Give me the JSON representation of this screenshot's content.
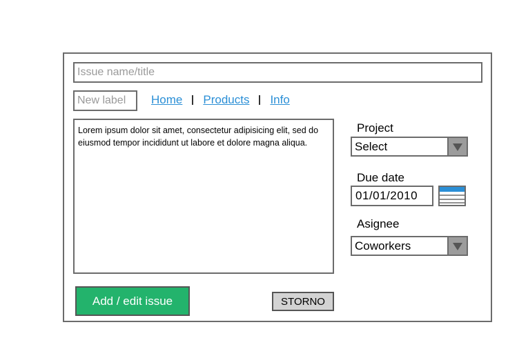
{
  "form": {
    "title_placeholder": "Issue name/title",
    "label_placeholder": "New label",
    "description": "Lorem ipsum dolor sit amet, consectetur adipisicing elit, sed do eiusmod tempor incididunt ut labore et dolore magna aliqua."
  },
  "nav": {
    "items": [
      {
        "label": "Home"
      },
      {
        "label": "Products"
      },
      {
        "label": "Info"
      }
    ]
  },
  "sidebar": {
    "project_label": "Project",
    "project_value": "Select",
    "due_date_label": "Due date",
    "due_date_value": "01/01/2010",
    "assignee_label": "Asignee",
    "assignee_value": "Coworkers"
  },
  "actions": {
    "primary_label": "Add / edit issue",
    "secondary_label": "STORNO"
  },
  "colors": {
    "accent_green": "#23b36c",
    "link_blue": "#2b8fd6",
    "border_gray": "#6b6b6b"
  },
  "icons": {
    "dropdown": "chevron-down-icon",
    "calendar": "calendar-icon"
  }
}
